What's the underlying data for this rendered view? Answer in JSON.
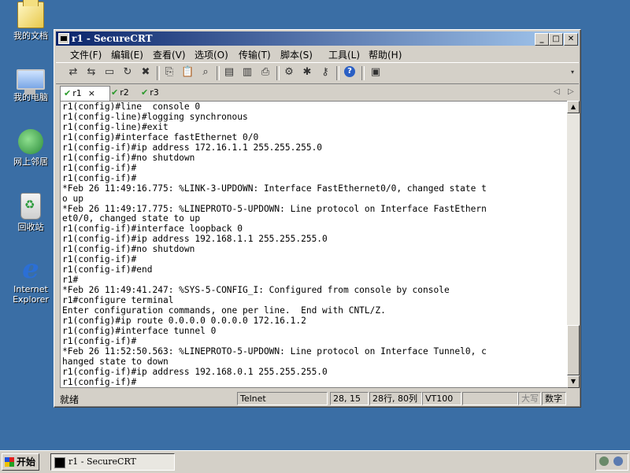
{
  "desktop": {
    "icons": [
      {
        "label": "我的文档",
        "icon": "my-documents-icon"
      },
      {
        "label": "我的电脑",
        "icon": "my-computer-icon"
      },
      {
        "label": "网上邻居",
        "icon": "network-places-icon"
      },
      {
        "label": "回收站",
        "icon": "recycle-bin-icon"
      },
      {
        "label": "Internet Explorer",
        "icon": "internet-explorer-icon"
      }
    ]
  },
  "window": {
    "title": "r1 - SecureCRT",
    "menu": [
      "文件(F)",
      "编辑(E)",
      "查看(V)",
      "选项(O)",
      "传输(T)",
      "脚本(S)",
      "工具(L)",
      "帮助(H)"
    ],
    "tabs": [
      {
        "label": "r1",
        "active": true,
        "close": "×"
      },
      {
        "label": "r2",
        "active": false
      },
      {
        "label": "r3",
        "active": false
      }
    ],
    "terminal_lines": [
      "r1(config)#line  console 0",
      "r1(config-line)#logging synchronous",
      "r1(config-line)#exit",
      "r1(config)#interface fastEthernet 0/0",
      "r1(config-if)#ip address 172.16.1.1 255.255.255.0",
      "r1(config-if)#no shutdown",
      "r1(config-if)#",
      "r1(config-if)#",
      "*Feb 26 11:49:16.775: %LINK-3-UPDOWN: Interface FastEthernet0/0, changed state t",
      "o up",
      "*Feb 26 11:49:17.775: %LINEPROTO-5-UPDOWN: Line protocol on Interface FastEthern",
      "et0/0, changed state to up",
      "r1(config-if)#interface loopback 0",
      "r1(config-if)#ip address 192.168.1.1 255.255.255.0",
      "r1(config-if)#no shutdown",
      "r1(config-if)#",
      "r1(config-if)#end",
      "r1#",
      "*Feb 26 11:49:41.247: %SYS-5-CONFIG_I: Configured from console by console",
      "r1#configure terminal",
      "Enter configuration commands, one per line.  End with CNTL/Z.",
      "r1(config)#ip route 0.0.0.0 0.0.0.0 172.16.1.2",
      "r1(config)#interface tunnel 0",
      "r1(config-if)#",
      "*Feb 26 11:52:50.563: %LINEPROTO-5-UPDOWN: Line protocol on Interface Tunnel0, c",
      "hanged state to down",
      "r1(config-if)#ip address 192.168.0.1 255.255.255.0",
      "r1(config-if)#"
    ],
    "status": {
      "ready": "就绪",
      "protocol": "Telnet",
      "cursor": "28, 15",
      "size": "28行, 80列",
      "emulation": "VT100",
      "caps": "大写",
      "num": "数字"
    }
  },
  "taskbar": {
    "start_label": "开始",
    "task_label": "r1 - SecureCRT"
  }
}
